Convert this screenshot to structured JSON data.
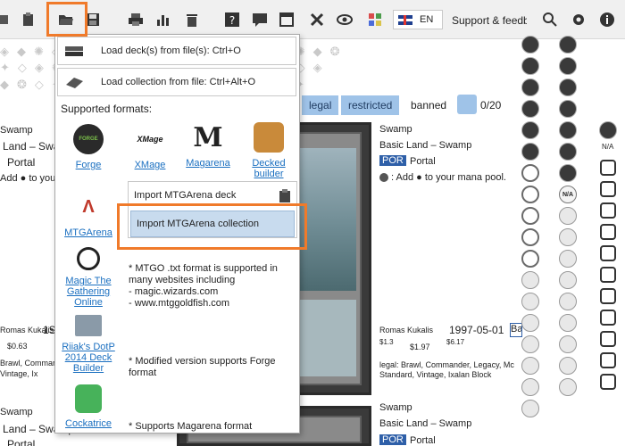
{
  "toolbar": {
    "language": "EN",
    "support": "Support & feedba"
  },
  "background": {
    "chips": {
      "legal": "legal",
      "restricted": "restricted",
      "banned": "banned",
      "count": "0/20"
    },
    "left_card": {
      "name": "Swamp",
      "type": "Land – Swamp",
      "set": "Portal",
      "ability": "Add ● to you",
      "artist": "Romas Kukalis",
      "year_frag": "1S",
      "price1": "$0.63",
      "legal1": "Brawl, Commar",
      "legal2": "Vintage, Ix"
    },
    "right_card": {
      "name": "Swamp",
      "type": "Basic Land – Swamp",
      "set_code": "POR",
      "set": "Portal",
      "ability": ": Add ● to your mana pool.",
      "artist": "Romas Kukalis",
      "date": "1997-05-01",
      "box": "Ba",
      "price_a": "$1.3",
      "price_b": "$1.97",
      "price_c": "$6.17",
      "legal1": "legal: Brawl, Commander, Legacy, Mc",
      "legal2": "Standard, Vintage, Ixalan Block"
    },
    "bottom_left": {
      "name": "Swamp",
      "type": "Land – Swamp",
      "set": "Portal"
    },
    "bottom_right": {
      "name": "Swamp",
      "type": "Basic Land – Swamp",
      "set_code": "POR",
      "set": "Portal"
    },
    "na": "N/A"
  },
  "dropdown": {
    "load_deck": "Load deck(s) from file(s): Ctrl+O",
    "load_collection": "Load collection from file: Ctrl+Alt+O",
    "supported": "Supported formats:",
    "formats": [
      {
        "label": "Forge",
        "logo": "FORGE"
      },
      {
        "label": "XMage",
        "logo": "XMage"
      },
      {
        "label": "Magarena",
        "logo": "M"
      },
      {
        "label": "Decked builder",
        "logo": ""
      },
      {
        "label": "MTGArena",
        "logo": ""
      },
      {
        "label": "Magic The Gathering Online",
        "logo": ""
      },
      {
        "label": "Riiak's DotP 2014 Deck Builder",
        "logo": ""
      },
      {
        "label": "Cockatrice",
        "logo": ""
      }
    ],
    "import_deck": "Import MTGArena deck",
    "import_collection": "Import MTGArena collection",
    "note_mtgo": "* MTGO .txt format is supported in many websites including",
    "note_site1": " - magic.wizards.com",
    "note_site2": " - www.mtggoldfish.com",
    "note_modified": "* Modified version supports Forge format",
    "note_magarena": "* Supports Magarena format"
  },
  "colors": {
    "accent": "#f07a2a",
    "link": "#1a6fc0",
    "chip": "#9fc3e8",
    "highlight": "#c8dbee"
  }
}
